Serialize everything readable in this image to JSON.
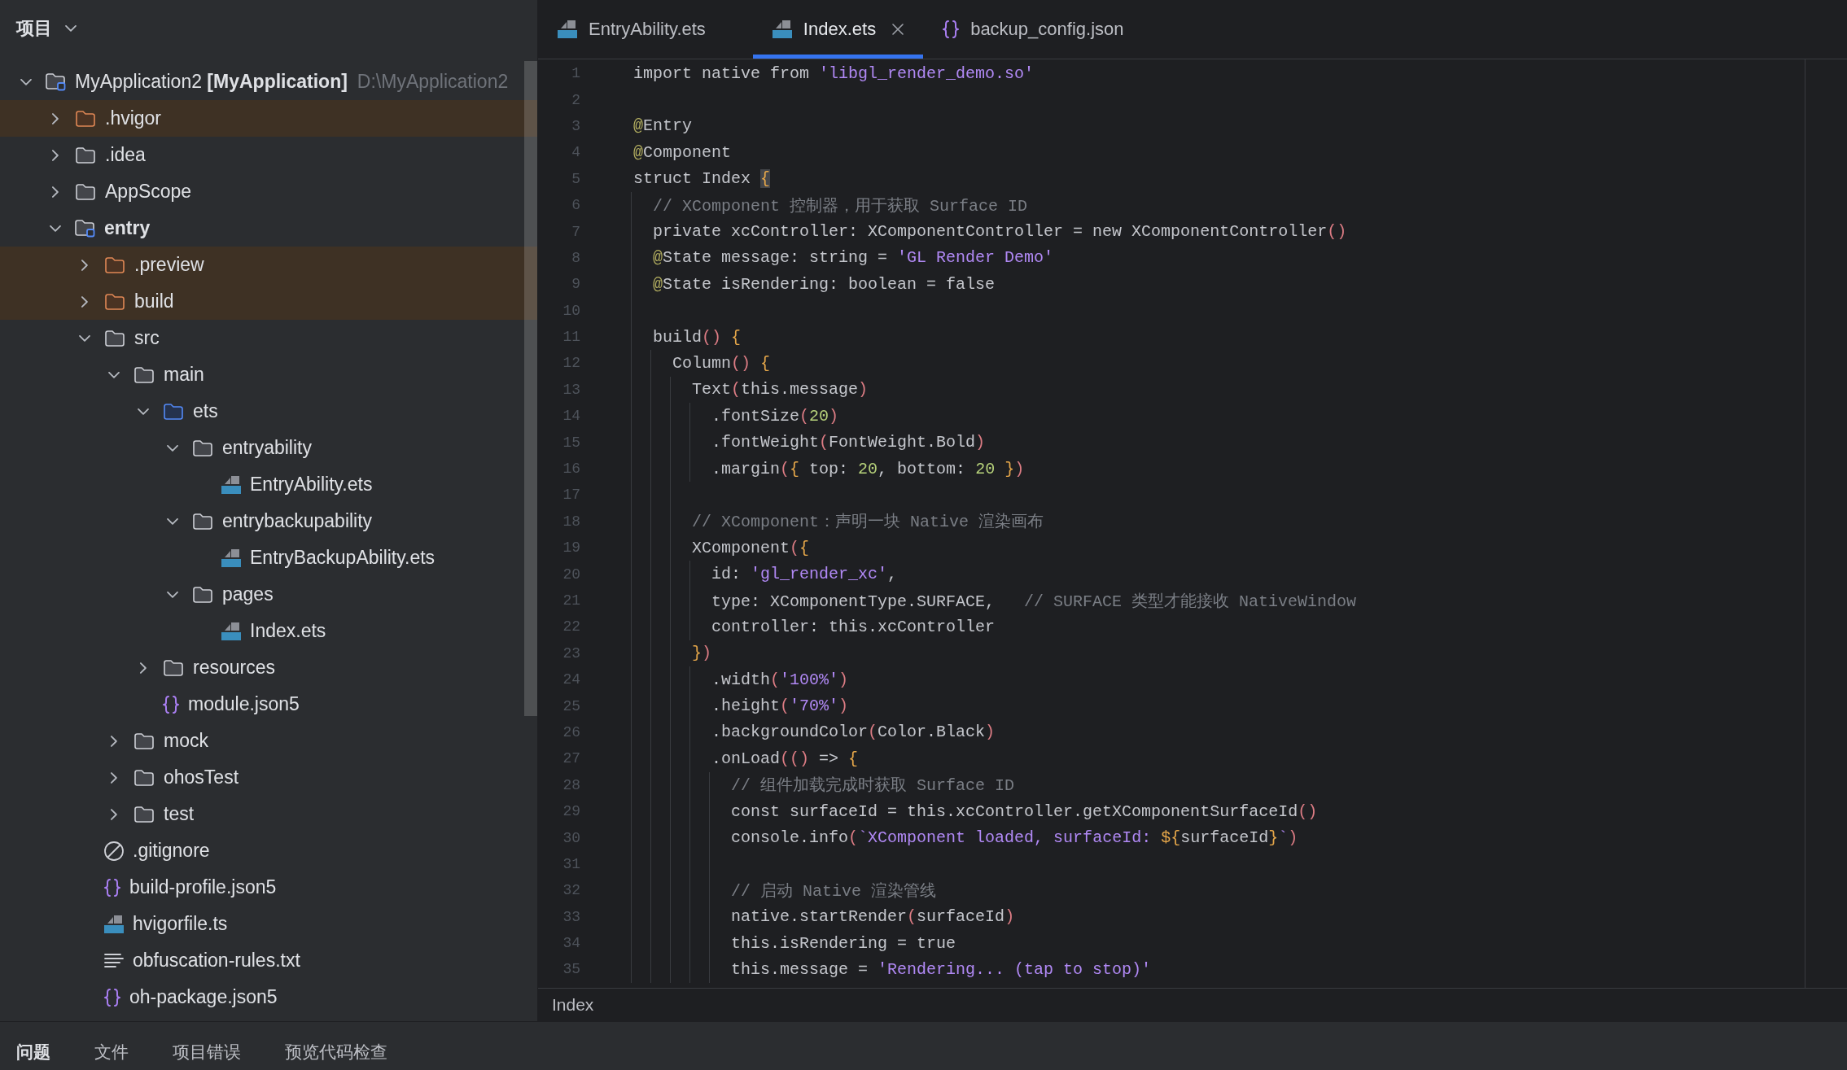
{
  "project_panel": {
    "title": "项目",
    "tree": [
      {
        "name": "MyApplication2 **[MyApplication]**",
        "path": "D:\\MyApplication2",
        "kind": "project",
        "expanded": true,
        "excluded": false,
        "children": [
          {
            "name": ".hvigor",
            "kind": "folder",
            "expanded": false,
            "excluded": true
          },
          {
            "name": ".idea",
            "kind": "folder",
            "expanded": false,
            "excluded": false
          },
          {
            "name": "AppScope",
            "kind": "folder",
            "expanded": false,
            "excluded": false
          },
          {
            "name": "entry",
            "kind": "module",
            "expanded": true,
            "excluded": false,
            "children": [
              {
                "name": ".preview",
                "kind": "folder",
                "expanded": false,
                "excluded": true
              },
              {
                "name": "build",
                "kind": "folder",
                "expanded": false,
                "excluded": true
              },
              {
                "name": "src",
                "kind": "folder",
                "expanded": true,
                "excluded": false,
                "children": [
                  {
                    "name": "main",
                    "kind": "folder",
                    "expanded": true,
                    "excluded": false,
                    "children": [
                      {
                        "name": "ets",
                        "kind": "source-folder",
                        "expanded": true,
                        "excluded": false,
                        "children": [
                          {
                            "name": "entryability",
                            "kind": "folder",
                            "expanded": true,
                            "excluded": false,
                            "children": [
                              {
                                "name": "EntryAbility.ets",
                                "kind": "ets-file",
                                "excluded": false
                              }
                            ]
                          },
                          {
                            "name": "entrybackupability",
                            "kind": "folder",
                            "expanded": true,
                            "excluded": false,
                            "children": [
                              {
                                "name": "EntryBackupAbility.ets",
                                "kind": "ets-file",
                                "excluded": false
                              }
                            ]
                          },
                          {
                            "name": "pages",
                            "kind": "folder",
                            "expanded": true,
                            "excluded": false,
                            "children": [
                              {
                                "name": "Index.ets",
                                "kind": "ets-file",
                                "excluded": false
                              }
                            ]
                          }
                        ]
                      },
                      {
                        "name": "resources",
                        "kind": "folder",
                        "expanded": false,
                        "excluded": false
                      },
                      {
                        "name": "module.json5",
                        "kind": "json-file",
                        "excluded": false
                      }
                    ]
                  },
                  {
                    "name": "mock",
                    "kind": "folder",
                    "expanded": false,
                    "excluded": false
                  },
                  {
                    "name": "ohosTest",
                    "kind": "folder",
                    "expanded": false,
                    "excluded": false
                  },
                  {
                    "name": "test",
                    "kind": "folder",
                    "expanded": false,
                    "excluded": false
                  }
                ]
              },
              {
                "name": ".gitignore",
                "kind": "ignore-file",
                "excluded": false
              },
              {
                "name": "build-profile.json5",
                "kind": "json-file",
                "excluded": false
              },
              {
                "name": "hvigorfile.ts",
                "kind": "ts-file",
                "excluded": false
              },
              {
                "name": "obfuscation-rules.txt",
                "kind": "text-file",
                "excluded": false
              },
              {
                "name": "oh-package.json5",
                "kind": "json-file",
                "excluded": false
              }
            ]
          }
        ]
      }
    ]
  },
  "editor": {
    "tabs": [
      {
        "label": "EntryAbility.ets",
        "kind": "ets",
        "selected": false
      },
      {
        "label": "Index.ets",
        "kind": "ets",
        "selected": true
      },
      {
        "label": "backup_config.json",
        "kind": "json",
        "selected": false
      }
    ],
    "lines": [
      {
        "number": "1",
        "tokens": [
          {
            "kind": "plain",
            "text": "import native from "
          },
          {
            "kind": "string",
            "text": "'libgl_render_demo.so'"
          }
        ]
      },
      {
        "number": "2"
      },
      {
        "number": "3",
        "tokens": [
          {
            "kind": "annotation",
            "text": "@"
          },
          {
            "kind": "plain",
            "text": "Entry"
          }
        ]
      },
      {
        "number": "4",
        "tokens": [
          {
            "kind": "annotation",
            "text": "@"
          },
          {
            "kind": "plain",
            "text": "Component"
          }
        ]
      },
      {
        "number": "5",
        "tokens": [
          {
            "kind": "plain",
            "text": "struct Index "
          },
          {
            "kind": "brace-match",
            "text": "{"
          }
        ]
      },
      {
        "number": "6",
        "tokens": [
          {
            "kind": "comment",
            "text": "  // XComponent 控制器，用于获取 Surface ID"
          }
        ]
      },
      {
        "number": "7",
        "tokens": [
          {
            "kind": "plain",
            "text": "  private xcController: XComponentController = new XComponentController"
          },
          {
            "kind": "paren",
            "text": "()"
          }
        ]
      },
      {
        "number": "8",
        "tokens": [
          {
            "kind": "annotation",
            "text": "  @"
          },
          {
            "kind": "plain",
            "text": "State message: string = "
          },
          {
            "kind": "string",
            "text": "'GL Render Demo'"
          }
        ]
      },
      {
        "number": "9",
        "tokens": [
          {
            "kind": "annotation",
            "text": "  @"
          },
          {
            "kind": "plain",
            "text": "State isRendering: boolean = false"
          }
        ]
      },
      {
        "number": "10"
      },
      {
        "number": "11",
        "tokens": [
          {
            "kind": "plain",
            "text": "  build"
          },
          {
            "kind": "paren",
            "text": "()"
          },
          {
            "kind": "brace",
            "text": " {"
          }
        ]
      },
      {
        "number": "12",
        "tokens": [
          {
            "kind": "plain",
            "text": "    Column"
          },
          {
            "kind": "paren",
            "text": "()"
          },
          {
            "kind": "brace",
            "text": " {"
          }
        ]
      },
      {
        "number": "13",
        "tokens": [
          {
            "kind": "plain",
            "text": "      Text"
          },
          {
            "kind": "paren",
            "text": "("
          },
          {
            "kind": "plain",
            "text": "this.message"
          },
          {
            "kind": "paren",
            "text": ")"
          }
        ]
      },
      {
        "number": "14",
        "tokens": [
          {
            "kind": "plain",
            "text": "        .fontSize"
          },
          {
            "kind": "paren",
            "text": "("
          },
          {
            "kind": "number",
            "text": "20"
          },
          {
            "kind": "paren",
            "text": ")"
          }
        ]
      },
      {
        "number": "15",
        "tokens": [
          {
            "kind": "plain",
            "text": "        .fontWeight"
          },
          {
            "kind": "paren",
            "text": "("
          },
          {
            "kind": "plain",
            "text": "FontWeight.Bold"
          },
          {
            "kind": "paren",
            "text": ")"
          }
        ]
      },
      {
        "number": "16",
        "tokens": [
          {
            "kind": "plain",
            "text": "        .margin"
          },
          {
            "kind": "paren",
            "text": "("
          },
          {
            "kind": "brace",
            "text": "{"
          },
          {
            "kind": "plain",
            "text": " top: "
          },
          {
            "kind": "number",
            "text": "20"
          },
          {
            "kind": "plain",
            "text": ", bottom: "
          },
          {
            "kind": "number",
            "text": "20"
          },
          {
            "kind": "brace",
            "text": " }"
          },
          {
            "kind": "paren",
            "text": ")"
          }
        ]
      },
      {
        "number": "17"
      },
      {
        "number": "18",
        "tokens": [
          {
            "kind": "comment",
            "text": "      // XComponent：声明一块 Native 渲染画布"
          }
        ]
      },
      {
        "number": "19",
        "tokens": [
          {
            "kind": "plain",
            "text": "      XComponent"
          },
          {
            "kind": "paren",
            "text": "("
          },
          {
            "kind": "brace",
            "text": "{"
          }
        ]
      },
      {
        "number": "20",
        "tokens": [
          {
            "kind": "plain",
            "text": "        id: "
          },
          {
            "kind": "string",
            "text": "'gl_render_xc'"
          },
          {
            "kind": "plain",
            "text": ","
          }
        ]
      },
      {
        "number": "21",
        "tokens": [
          {
            "kind": "plain",
            "text": "        type: XComponentType.SURFACE,   "
          },
          {
            "kind": "comment",
            "text": "// SURFACE 类型才能接收 NativeWindow"
          }
        ]
      },
      {
        "number": "22",
        "tokens": [
          {
            "kind": "plain",
            "text": "        controller: this.xcController"
          }
        ]
      },
      {
        "number": "23",
        "tokens": [
          {
            "kind": "brace",
            "text": "      }"
          },
          {
            "kind": "paren",
            "text": ")"
          }
        ]
      },
      {
        "number": "24",
        "tokens": [
          {
            "kind": "plain",
            "text": "        .width"
          },
          {
            "kind": "paren",
            "text": "("
          },
          {
            "kind": "string",
            "text": "'100%'"
          },
          {
            "kind": "paren",
            "text": ")"
          }
        ]
      },
      {
        "number": "25",
        "tokens": [
          {
            "kind": "plain",
            "text": "        .height"
          },
          {
            "kind": "paren",
            "text": "("
          },
          {
            "kind": "string",
            "text": "'70%'"
          },
          {
            "kind": "paren",
            "text": ")"
          }
        ]
      },
      {
        "number": "26",
        "tokens": [
          {
            "kind": "plain",
            "text": "        .backgroundColor"
          },
          {
            "kind": "paren",
            "text": "("
          },
          {
            "kind": "plain",
            "text": "Color.Black"
          },
          {
            "kind": "paren",
            "text": ")"
          }
        ]
      },
      {
        "number": "27",
        "tokens": [
          {
            "kind": "plain",
            "text": "        .onLoad"
          },
          {
            "kind": "paren",
            "text": "(()"
          },
          {
            "kind": "plain",
            "text": " => "
          },
          {
            "kind": "brace",
            "text": "{"
          }
        ]
      },
      {
        "number": "28",
        "tokens": [
          {
            "kind": "comment",
            "text": "          // 组件加载完成时获取 Surface ID"
          }
        ]
      },
      {
        "number": "29",
        "tokens": [
          {
            "kind": "plain",
            "text": "          const surfaceId = this.xcController.getXComponentSurfaceId"
          },
          {
            "kind": "paren",
            "text": "()"
          }
        ]
      },
      {
        "number": "30",
        "tokens": [
          {
            "kind": "plain",
            "text": "          console.info"
          },
          {
            "kind": "paren",
            "text": "("
          },
          {
            "kind": "string",
            "text": "`XComponent loaded, surfaceId: "
          },
          {
            "kind": "brace",
            "text": "${"
          },
          {
            "kind": "plain",
            "text": "surfaceId"
          },
          {
            "kind": "brace",
            "text": "}"
          },
          {
            "kind": "string",
            "text": "`"
          },
          {
            "kind": "paren",
            "text": ")"
          }
        ]
      },
      {
        "number": "31"
      },
      {
        "number": "32",
        "tokens": [
          {
            "kind": "comment",
            "text": "          // 启动 Native 渲染管线"
          }
        ]
      },
      {
        "number": "33",
        "tokens": [
          {
            "kind": "plain",
            "text": "          native.startRender"
          },
          {
            "kind": "paren",
            "text": "("
          },
          {
            "kind": "plain",
            "text": "surfaceId"
          },
          {
            "kind": "paren",
            "text": ")"
          }
        ]
      },
      {
        "number": "34",
        "tokens": [
          {
            "kind": "plain",
            "text": "          this.isRendering = true"
          }
        ]
      },
      {
        "number": "35",
        "tokens": [
          {
            "kind": "plain",
            "text": "          this.message = "
          },
          {
            "kind": "string",
            "text": "'Rendering... (tap to stop)'"
          }
        ]
      }
    ],
    "breadcrumb": "Index"
  },
  "bottom_panel": {
    "tabs": [
      {
        "label": "问题",
        "selected": true
      },
      {
        "label": "文件",
        "selected": false
      },
      {
        "label": "项目错误",
        "selected": false
      },
      {
        "label": "预览代码检查",
        "selected": false
      }
    ]
  }
}
